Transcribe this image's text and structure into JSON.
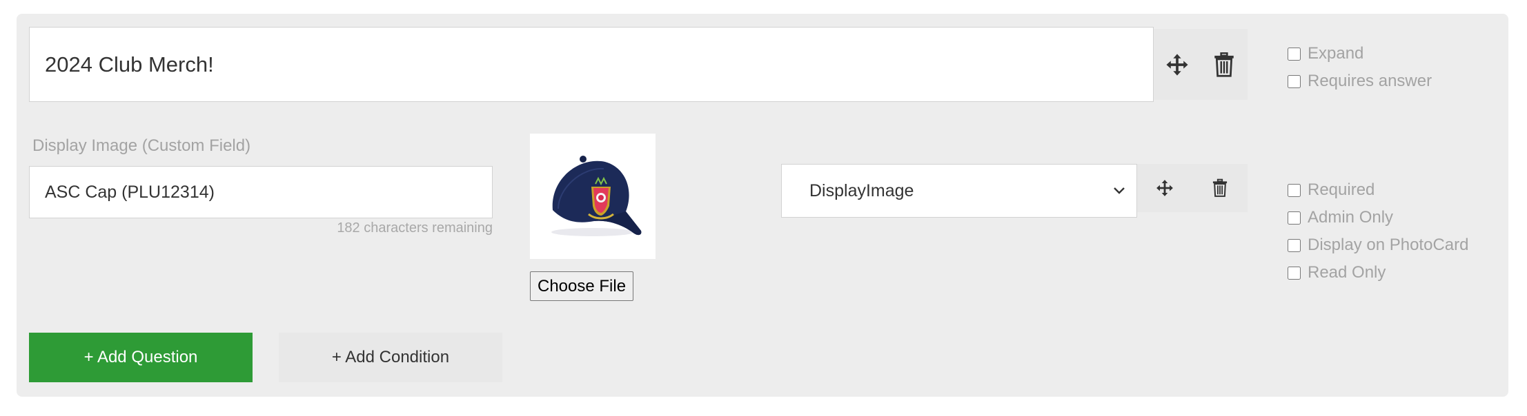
{
  "question": {
    "title_value": "2024 Club Merch!",
    "options": [
      {
        "label": "Expand",
        "checked": false
      },
      {
        "label": "Requires answer",
        "checked": false
      }
    ]
  },
  "field": {
    "label": "Display Image (Custom Field)",
    "value": "ASC Cap (PLU12314)",
    "remaining": "182 characters remaining",
    "image_alt": "ASC Cap",
    "file_button": "Choose File",
    "type_selected": "DisplayImage",
    "options": [
      {
        "label": "Required",
        "checked": false
      },
      {
        "label": "Admin Only",
        "checked": false
      },
      {
        "label": "Display on PhotoCard",
        "checked": false
      },
      {
        "label": "Read Only",
        "checked": false
      }
    ]
  },
  "actions": {
    "add_question": "+ Add Question",
    "add_condition": "+ Add Condition"
  },
  "colors": {
    "panel": "#ededed",
    "primary_green": "#2e9b36",
    "muted_text": "#a3a3a3",
    "icon": "#333333"
  },
  "icons": [
    "move-icon",
    "trash-icon",
    "chevron-down-icon"
  ]
}
